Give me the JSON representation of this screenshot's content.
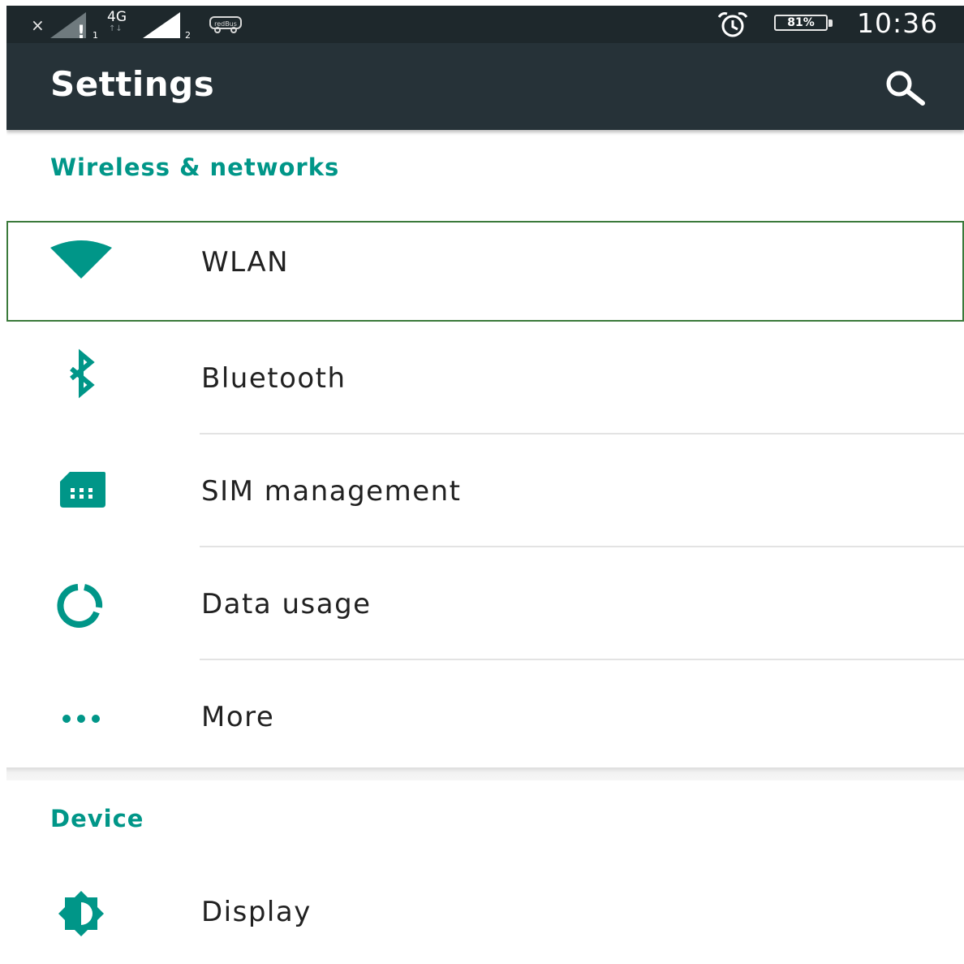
{
  "status_bar": {
    "x_mark": "×",
    "sim1_warning": "!",
    "sim1_index": "1",
    "network_type": "4G",
    "data_arrows": "↑↓",
    "sim2_index": "2",
    "bus_icon_text": "redBus",
    "battery": "81%",
    "time": "10:36"
  },
  "app_bar": {
    "title": "Settings"
  },
  "sections": {
    "wireless": {
      "header": "Wireless & networks",
      "items": [
        {
          "label": "WLAN",
          "icon": "wifi-icon"
        },
        {
          "label": "Bluetooth",
          "icon": "bluetooth-icon"
        },
        {
          "label": "SIM management",
          "icon": "sim-card-icon"
        },
        {
          "label": "Data usage",
          "icon": "data-usage-icon"
        },
        {
          "label": "More",
          "icon": "more-dots-icon"
        }
      ]
    },
    "device": {
      "header": "Device",
      "items": [
        {
          "label": "Display",
          "icon": "brightness-icon"
        }
      ]
    }
  },
  "colors": {
    "status_bar_bg": "#1e282c",
    "app_bar_bg": "#263238",
    "accent": "#009688",
    "selection_border": "#3b7a3b",
    "text_primary": "#212121"
  }
}
